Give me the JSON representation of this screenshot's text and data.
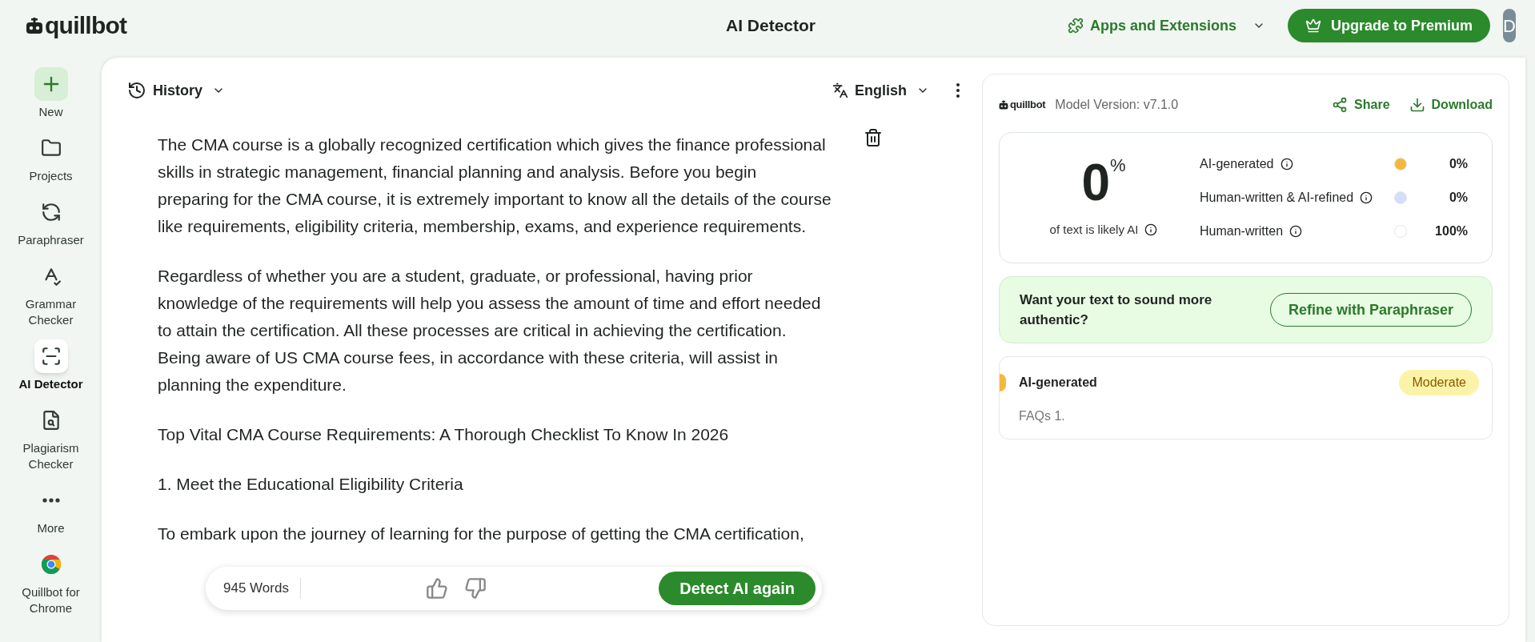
{
  "header": {
    "logo": "quillbot",
    "title": "AI Detector",
    "apps_menu": "Apps and Extensions",
    "upgrade_button": "Upgrade to Premium",
    "avatar": "D"
  },
  "sidebar": {
    "items": [
      {
        "kind": "new",
        "label": "New",
        "selected": false
      },
      {
        "kind": "projects",
        "label": "Projects",
        "selected": false
      },
      {
        "kind": "paraphraser",
        "label": "Paraphraser",
        "selected": false
      },
      {
        "kind": "grammar",
        "label": "Grammar Checker",
        "selected": false
      },
      {
        "kind": "detector",
        "label": "AI Detector",
        "selected": true
      },
      {
        "kind": "plagiarism",
        "label": "Plagiarism Checker",
        "selected": false
      },
      {
        "kind": "more",
        "label": "More",
        "selected": false
      },
      {
        "kind": "chrome",
        "label": "Quillbot for Chrome",
        "selected": false
      }
    ]
  },
  "editor": {
    "history": "History",
    "language": "English",
    "paragraphs": [
      "The CMA course is a globally recognized certification which gives the finance professional skills in strategic management, financial planning and analysis. Before you begin preparing for the CMA course, it is extremely important to know all the details of the course like requirements, eligibility criteria, membership, exams, and experience requirements.",
      "Regardless of whether you are a student, graduate, or professional, having prior knowledge of the requirements will help you assess the amount of time and effort needed to attain the certification. All these processes are critical in achieving the certification. Being aware of US CMA course fees, in accordance with these criteria, will assist in planning the expenditure.",
      "Top Vital CMA Course Requirements: A Thorough Checklist To Know In 2026",
      "1. Meet the Educational Eligibility Criteria",
      "To embark upon the journey of learning for the purpose of getting the CMA certification,"
    ],
    "word_count": "945 Words",
    "detect_button": "Detect AI again"
  },
  "results": {
    "logo": "quillbot",
    "model_version": "Model Version: v7.1.0",
    "share": "Share",
    "download": "Download",
    "score": "0",
    "score_unit": "%",
    "score_caption": "of text is likely AI",
    "legend": [
      {
        "label": "AI-generated",
        "color": "#f6b73c",
        "value": "0%"
      },
      {
        "label": "Human-written & AI-refined",
        "color": "#d3dff8",
        "value": "0%"
      },
      {
        "label": "Human-written",
        "color": "#ffffff",
        "value": "100%"
      }
    ],
    "promo": {
      "text": "Want your text to sound more authentic?",
      "button": "Refine with Paraphraser"
    },
    "segments": [
      {
        "label": "AI-generated",
        "color": "#f6b73c",
        "badge": "Moderate",
        "excerpt": "FAQs 1."
      }
    ]
  }
}
